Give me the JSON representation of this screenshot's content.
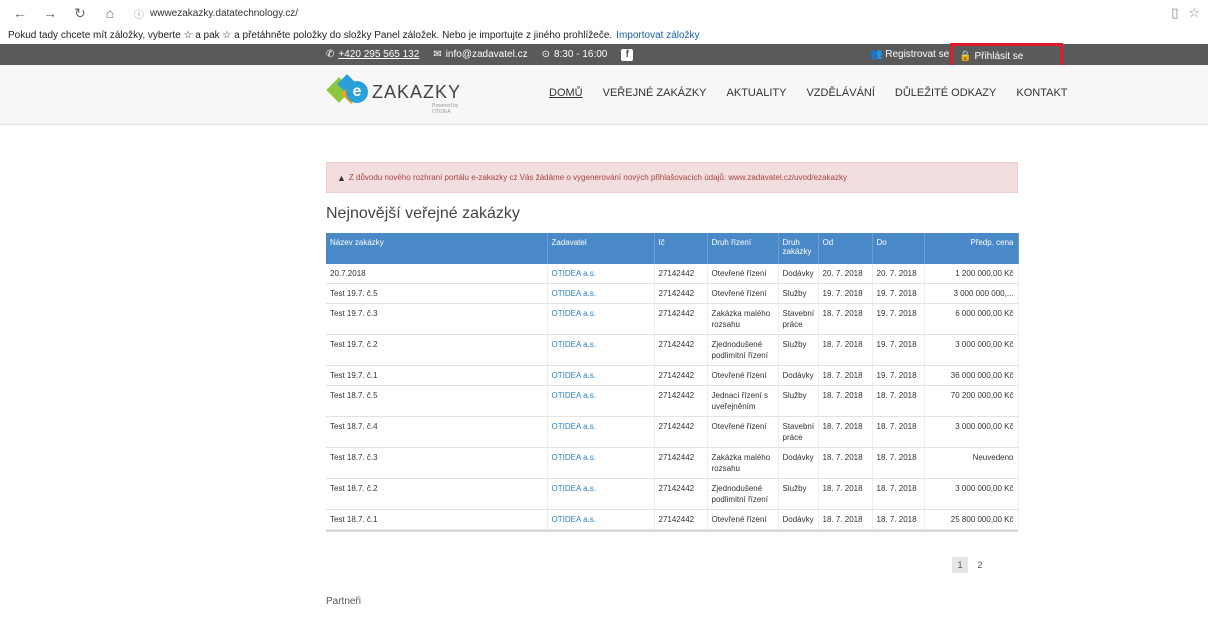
{
  "browser": {
    "url": "wwwezakazky.datatechnology.cz/",
    "bookmarks_text": "Pokud tady chcete mít záložky, vyberte ☆ a pak ☆ a přetáhněte položky do složky Panel záložek. Nebo je importujte z jiného prohlížeče.",
    "import_link": "Importovat záložky"
  },
  "topbar": {
    "phone": "+420 295 565 132",
    "email": "info@zadavatel.cz",
    "hours": "8:30 - 16:00",
    "facebook": "f",
    "register": "Registrovat se",
    "login": "Přihlásit se",
    "highlight_color": "#e0192b"
  },
  "logo": {
    "text": "ZAKAZKY",
    "letter": "e",
    "sub": "Powered by OTIDEA"
  },
  "nav": {
    "items": [
      "DOMŮ",
      "VEŘEJNÉ ZAKÁZKY",
      "AKTUALITY",
      "VZDĚLÁVÁNÍ",
      "DŮLEŽITÉ ODKAZY",
      "KONTAKT"
    ]
  },
  "alert": {
    "text": "Z důvodu nového rozhraní portálu e-zakazky cz Vás žádáme o vygenerování nových přihlašovacích údajů: www.zadavatel.cz/uvod/ezakazky"
  },
  "section_title": "Nejnovější veřejné zakázky",
  "table": {
    "headers": [
      "Název zakázky",
      "Zadavatel",
      "Ič",
      "Druh řízení",
      "Druh zakázky",
      "Od",
      "Do",
      "Předp. cena"
    ],
    "rows": [
      [
        "20.7.2018",
        "OTIDEA a.s.",
        "27142442",
        "Otevřené řízení",
        "Dodávky",
        "20. 7. 2018",
        "20. 7. 2018",
        "1 200 000,00 Kč"
      ],
      [
        "Test 19.7. č.5",
        "OTIDEA a.s.",
        "27142442",
        "Otevřené řízení",
        "Služby",
        "19. 7. 2018",
        "19. 7. 2018",
        "3 000 000 000,..."
      ],
      [
        "Test 19.7. č.3",
        "OTIDEA a.s.",
        "27142442",
        "Zakázka malého rozsahu",
        "Stavební práce",
        "18. 7. 2018",
        "19. 7. 2018",
        "6 000 000,00 Kč"
      ],
      [
        "Test 19.7. č.2",
        "OTIDEA a.s.",
        "27142442",
        "Zjednodušené podlimitní řízení",
        "Služby",
        "18. 7. 2018",
        "19. 7. 2018",
        "3 000 000,00 Kč"
      ],
      [
        "Test 19.7. č.1",
        "OTIDEA a.s.",
        "27142442",
        "Otevřené řízení",
        "Dodávky",
        "18. 7. 2018",
        "19. 7. 2018",
        "36 000 000,00 Kč"
      ],
      [
        "Test 18.7. č.5",
        "OTIDEA a.s.",
        "27142442",
        "Jednací řízení s uveřejněním",
        "Služby",
        "18. 7. 2018",
        "18. 7. 2018",
        "70 200 000,00 Kč"
      ],
      [
        "Test 18.7. č.4",
        "OTIDEA a.s.",
        "27142442",
        "Otevřené řízení",
        "Stavební práce",
        "18. 7. 2018",
        "18. 7. 2018",
        "3 000 000,00 Kč"
      ],
      [
        "Test 18.7. č.3",
        "OTIDEA a.s.",
        "27142442",
        "Zakázka malého rozsahu",
        "Dodávky",
        "18. 7. 2018",
        "18. 7. 2018",
        "Neuvedeno"
      ],
      [
        "Test 18.7. č.2",
        "OTIDEA a.s.",
        "27142442",
        "Zjednodušené podlimitní řízení",
        "Služby",
        "18. 7. 2018",
        "18. 7. 2018",
        "3 000 000,00 Kč"
      ],
      [
        "Test 18.7. č.1",
        "OTIDEA a.s.",
        "27142442",
        "Otevřené řízení",
        "Dodávky",
        "18. 7. 2018",
        "18. 7. 2018",
        "25 800 000,00 Kč"
      ]
    ],
    "row_heights": [
      "row1",
      "row1",
      "row2",
      "row2",
      "row1",
      "row2",
      "row2",
      "row2",
      "row2",
      "row1"
    ]
  },
  "pagination": [
    "1",
    "2"
  ],
  "partners": "Partneři"
}
